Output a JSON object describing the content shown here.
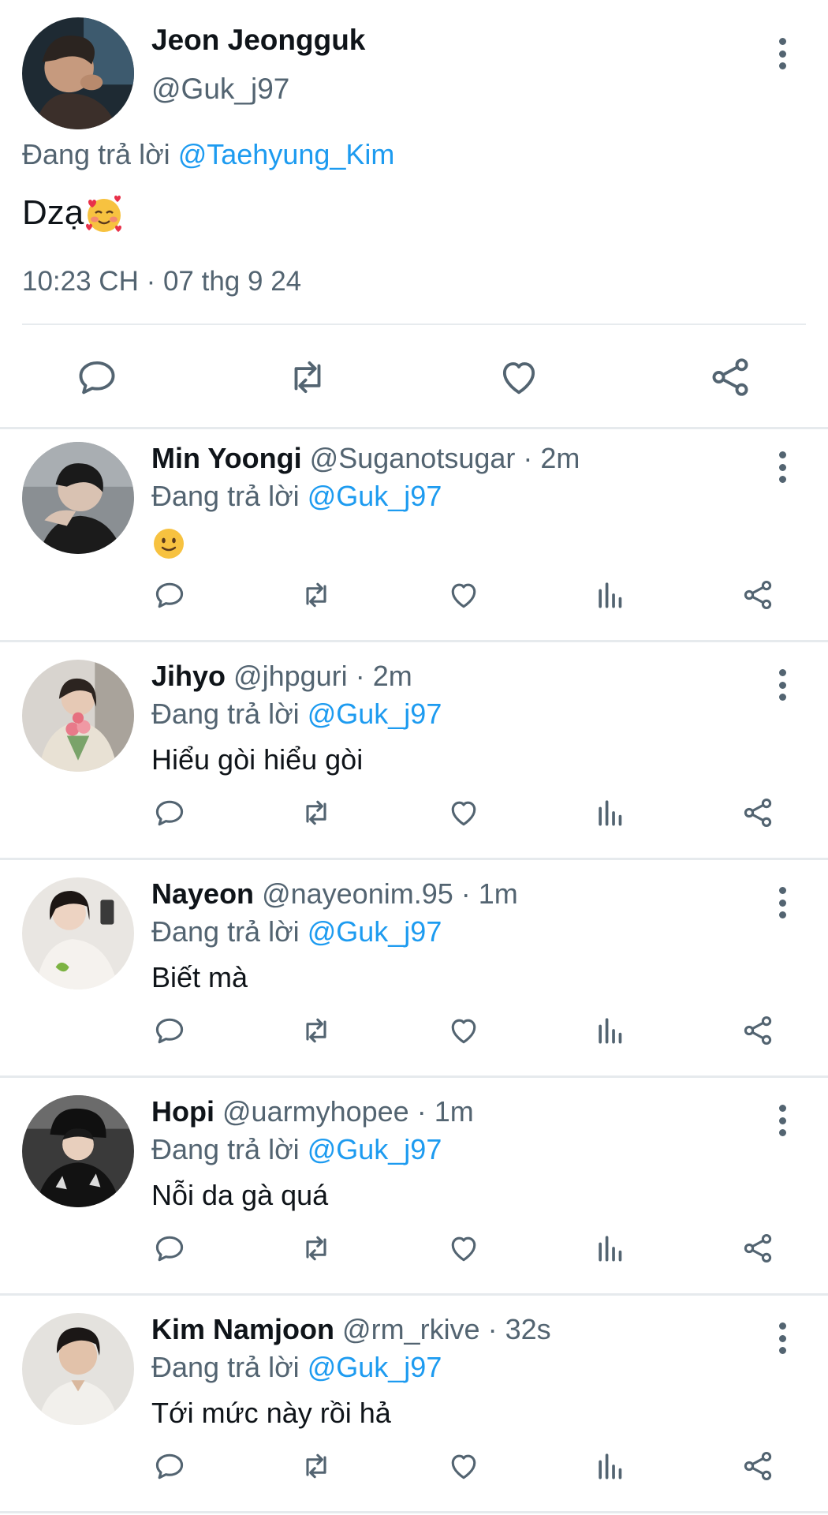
{
  "main_tweet": {
    "author_name": "Jeon Jeongguk",
    "author_handle": "@Guk_j97",
    "replying_prefix": "Đang trả lời",
    "replying_mention": "@Taehyung_Kim",
    "text": "Dzạ",
    "text_emoji": "smiling-face-with-hearts",
    "timestamp": "10:23 CH · 07 thg 9 24"
  },
  "replies": [
    {
      "name": "Min Yoongi",
      "handle": "@Suganotsugar",
      "time": "2m",
      "replying_prefix": "Đang trả lời",
      "mention": "@Guk_j97",
      "text": "",
      "emoji": "slightly-smiling-face"
    },
    {
      "name": "Jihyo",
      "handle": "@jhpguri",
      "time": "2m",
      "replying_prefix": "Đang trả lời",
      "mention": "@Guk_j97",
      "text": "Hiểu gòi hiểu gòi"
    },
    {
      "name": "Nayeon",
      "handle": "@nayeonim.95",
      "time": "1m",
      "replying_prefix": "Đang trả lời",
      "mention": "@Guk_j97",
      "text": "Biết mà"
    },
    {
      "name": "Hopi",
      "handle": "@uarmyhopee",
      "time": "1m",
      "replying_prefix": "Đang trả lời",
      "mention": "@Guk_j97",
      "text": "Nỗi da gà quá"
    },
    {
      "name": "Kim Namjoon",
      "handle": "@rm_rkive",
      "time": "32s",
      "replying_prefix": "Đang trả lời",
      "mention": "@Guk_j97",
      "text": "Tới mức này rồi hả"
    }
  ],
  "icons": {
    "main_actions": [
      "reply-icon",
      "retweet-icon",
      "like-icon",
      "share-icon"
    ],
    "reply_actions": [
      "reply-icon",
      "retweet-icon",
      "like-icon",
      "views-icon",
      "share-icon"
    ]
  },
  "colors": {
    "accent": "#1d9bf0",
    "secondary_text": "#536471",
    "primary_text": "#0f1419",
    "divider": "#e6eaed"
  }
}
